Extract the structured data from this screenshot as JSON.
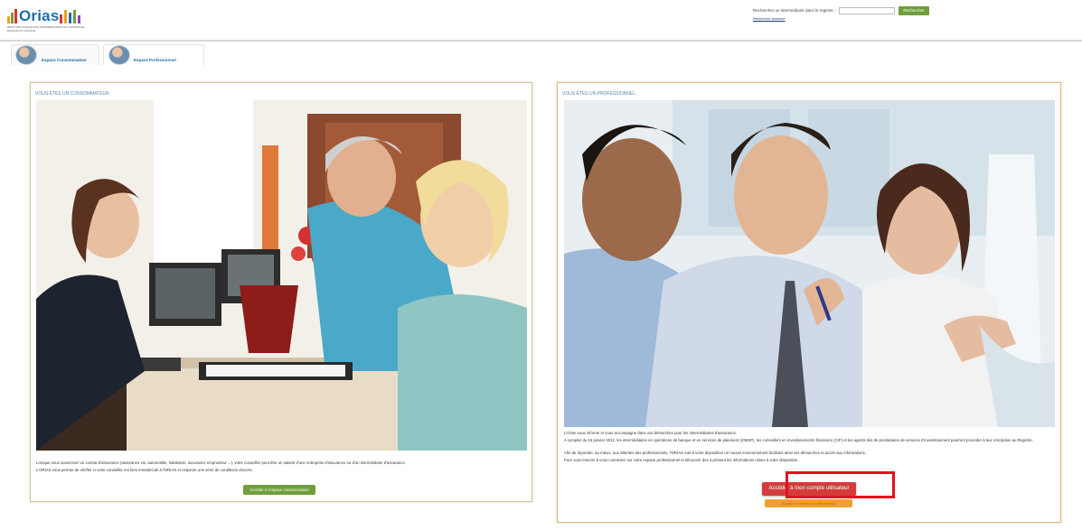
{
  "header": {
    "logo_text": "Orias",
    "logo_subtitle": "REGISTRE UNIQUE DES INTERMEDIAIRES EN ASSURANCE, BANQUE ET FINANCE",
    "search_label": "Rechercher un intermédiaire dans le registre :",
    "search_value": "",
    "search_button": "Rechercher",
    "advanced_search": "Recherche avancée"
  },
  "tabs": [
    {
      "label": "Espace Consommateur"
    },
    {
      "label": "Espace Professionnel"
    }
  ],
  "left_panel": {
    "title": "VOUS ÊTES UN CONSOMMATEUR",
    "paragraphs": [
      "Lorsque vous souscrivez un contrat d'assurance (assurance vie, automobile, habitation, assurance emprunteur ...), votre conseiller peut être un salarié d'une entreprise d'assurance ou d'un intermédiaire d'assurance.",
      "L'ORIAS vous permet de vérifier si votre conseiller est bien immatriculé à l'ORIAS et respecte une série de conditions d'accès."
    ],
    "button": "Accéder à l'espace consommateur"
  },
  "right_panel": {
    "title": "VOUS ÊTES UN PROFESSIONNEL",
    "paragraphs": [
      "L'Orias vous informe et vous accompagne dans vos démarches pour les intermédiaires d'assurance.",
      "A compter du 15 janvier 2013, les intermédiaires en opérations de banque et en services de paiement (IOBSP), les conseillers en investissements financiers (CIF) et les agents liés de prestataires de services d'investissement pourront procéder à leur inscription au Registre.",
      "Afin de répondre, au mieux, aux attentes des professionnels, l'ORIAS met à votre disposition un nouvel environnement facilitant ainsi vos démarches et accès aux informations.",
      "Pour vous inscrire à vous connecter sur votre espace professionnel et découvrir des à présent les informations mises à votre disposition."
    ],
    "button_primary": "Accéder à mon compte utilisateur",
    "button_secondary": "Accéder à l'espace professionnel"
  },
  "colors": {
    "brand_blue": "#1b6fa8",
    "green": "#6f9e3b",
    "red": "#d43c3c",
    "orange": "#f0a030",
    "highlight": "#e4101c"
  }
}
